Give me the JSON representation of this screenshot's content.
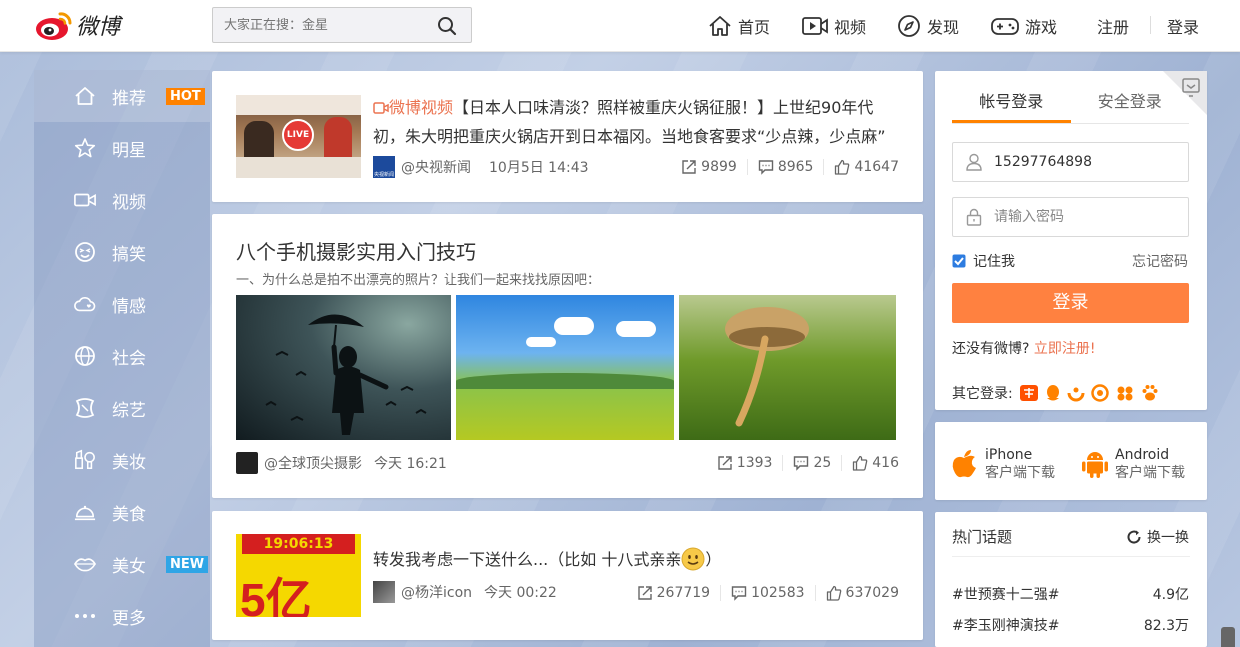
{
  "header": {
    "logo_text": "微博",
    "search_placeholder": "大家正在搜：金星",
    "nav": {
      "home": "首页",
      "video": "视频",
      "discover": "发现",
      "games": "游戏",
      "register": "注册",
      "login": "登录"
    }
  },
  "sidebar": {
    "items": [
      {
        "label": "推荐",
        "badge": "HOT"
      },
      {
        "label": "明星"
      },
      {
        "label": "视频"
      },
      {
        "label": "搞笑"
      },
      {
        "label": "情感"
      },
      {
        "label": "社会"
      },
      {
        "label": "综艺"
      },
      {
        "label": "美妆"
      },
      {
        "label": "美食"
      },
      {
        "label": "美女",
        "badge": "NEW"
      },
      {
        "label": "更多"
      }
    ]
  },
  "feed": [
    {
      "tag": "微博视频",
      "text": "【日本人口味清淡？照样被重庆火锅征服！】上世纪90年代初，朱大明把重庆火锅店开到日本福冈。当地食客要求“少点辣，少点麻”",
      "author": "@央视新闻",
      "time": "10月5日 14:43",
      "reposts": "9899",
      "comments": "8965",
      "likes": "41647",
      "live_label": "LIVE",
      "avatar_label": "央视新闻"
    },
    {
      "title": "八个手机摄影实用入门技巧",
      "subtitle": "一、为什么总是拍不出漂亮的照片？让我们一起来找找原因吧：",
      "author": "@全球顶尖摄影",
      "time": "今天 16:21",
      "reposts": "1393",
      "comments": "25",
      "likes": "416"
    },
    {
      "text": "转发我考虑一下送什么...（比如 十八式亲亲",
      "text_end": "）",
      "author": "@杨洋icon",
      "time": "今天 00:22",
      "reposts": "267719",
      "comments": "102583",
      "likes": "637029",
      "image_digits": "19:06:13",
      "image_big": "5亿"
    }
  ],
  "login": {
    "tab_account": "帐号登录",
    "tab_secure": "安全登录",
    "username": "15297764898",
    "password_placeholder": "请输入密码",
    "remember": "记住我",
    "forgot": "忘记密码",
    "submit": "登录",
    "no_account": "还没有微博?",
    "register_now": "立即注册!",
    "other_login": "其它登录:"
  },
  "download": {
    "iphone_title": "iPhone",
    "iphone_sub": "客户端下载",
    "android_title": "Android",
    "android_sub": "客户端下载"
  },
  "hot_topics": {
    "title": "热门话题",
    "refresh": "换一换",
    "items": [
      {
        "name": "#世预赛十二强#",
        "count": "4.9亿"
      },
      {
        "name": "#李玉刚神演技#",
        "count": "82.3万"
      }
    ]
  },
  "colors": {
    "accent": "#ff8200",
    "link": "#eb7350"
  }
}
